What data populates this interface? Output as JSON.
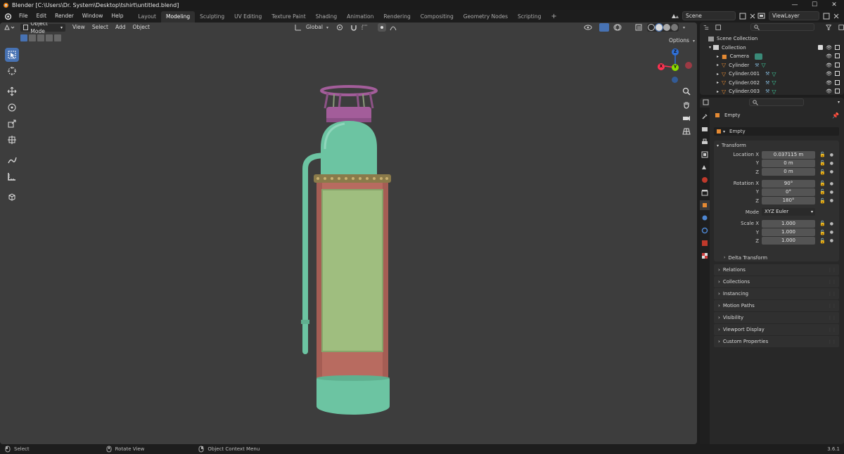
{
  "titlebar": {
    "title": "Blender [C:\\Users\\Dr. System\\Desktop\\tshirt\\untitled.blend]",
    "minimize": "—",
    "maximize": "☐",
    "close": "✕"
  },
  "menus": [
    "File",
    "Edit",
    "Render",
    "Window",
    "Help"
  ],
  "workspaces": [
    {
      "label": "Layout",
      "active": false
    },
    {
      "label": "Modeling",
      "active": true
    },
    {
      "label": "Sculpting",
      "active": false
    },
    {
      "label": "UV Editing",
      "active": false
    },
    {
      "label": "Texture Paint",
      "active": false
    },
    {
      "label": "Shading",
      "active": false
    },
    {
      "label": "Animation",
      "active": false
    },
    {
      "label": "Rendering",
      "active": false
    },
    {
      "label": "Compositing",
      "active": false
    },
    {
      "label": "Geometry Nodes",
      "active": false
    },
    {
      "label": "Scripting",
      "active": false
    }
  ],
  "add_workspace": "+",
  "scene": {
    "label": "Scene"
  },
  "view_layer": {
    "label": "ViewLayer"
  },
  "viewport_header": {
    "mode": "Object Mode",
    "menus": [
      "View",
      "Select",
      "Add",
      "Object"
    ],
    "orientation": "Global",
    "options": "Options"
  },
  "gizmo": {
    "z": "Z",
    "y": "Y",
    "x": "X"
  },
  "outliner": {
    "scene_collection": "Scene Collection",
    "collection": "Collection",
    "items": [
      {
        "name": "Camera",
        "icon": "camera-icon"
      },
      {
        "name": "Cylinder",
        "icon": "mesh-icon"
      },
      {
        "name": "Cylinder.001",
        "icon": "mesh-icon"
      },
      {
        "name": "Cylinder.002",
        "icon": "mesh-icon"
      },
      {
        "name": "Cylinder.003",
        "icon": "mesh-icon"
      }
    ]
  },
  "properties": {
    "object_name": "Empty",
    "data_name": "Empty",
    "transform_header": "Transform",
    "location": {
      "label_x": "Location X",
      "label_y": "Y",
      "label_z": "Z",
      "x": "0.037115 m",
      "y": "0 m",
      "z": "0 m"
    },
    "rotation": {
      "label_x": "Rotation X",
      "label_y": "Y",
      "label_z": "Z",
      "x": "90°",
      "y": "0°",
      "z": "180°"
    },
    "mode": {
      "label": "Mode",
      "value": "XYZ Euler"
    },
    "scale": {
      "label_x": "Scale X",
      "label_y": "Y",
      "label_z": "Z",
      "x": "1.000",
      "y": "1.000",
      "z": "1.000"
    },
    "delta_transform": "Delta Transform",
    "panels": [
      "Relations",
      "Collections",
      "Instancing",
      "Motion Paths",
      "Visibility",
      "Viewport Display",
      "Custom Properties"
    ]
  },
  "statusbar": {
    "select": "Select",
    "rotate_view": "Rotate View",
    "context_menu": "Object Context Menu",
    "version": "3.6.1"
  },
  "colors": {
    "accent": "#4772b3",
    "object_orange": "#e58a33",
    "mesh_green": "#3fd1a0",
    "extinguisher_teal": "#6cc4a2",
    "extinguisher_body": "#b86b60",
    "label_green": "#9fbe7f",
    "top_purple": "#a35d9a"
  }
}
